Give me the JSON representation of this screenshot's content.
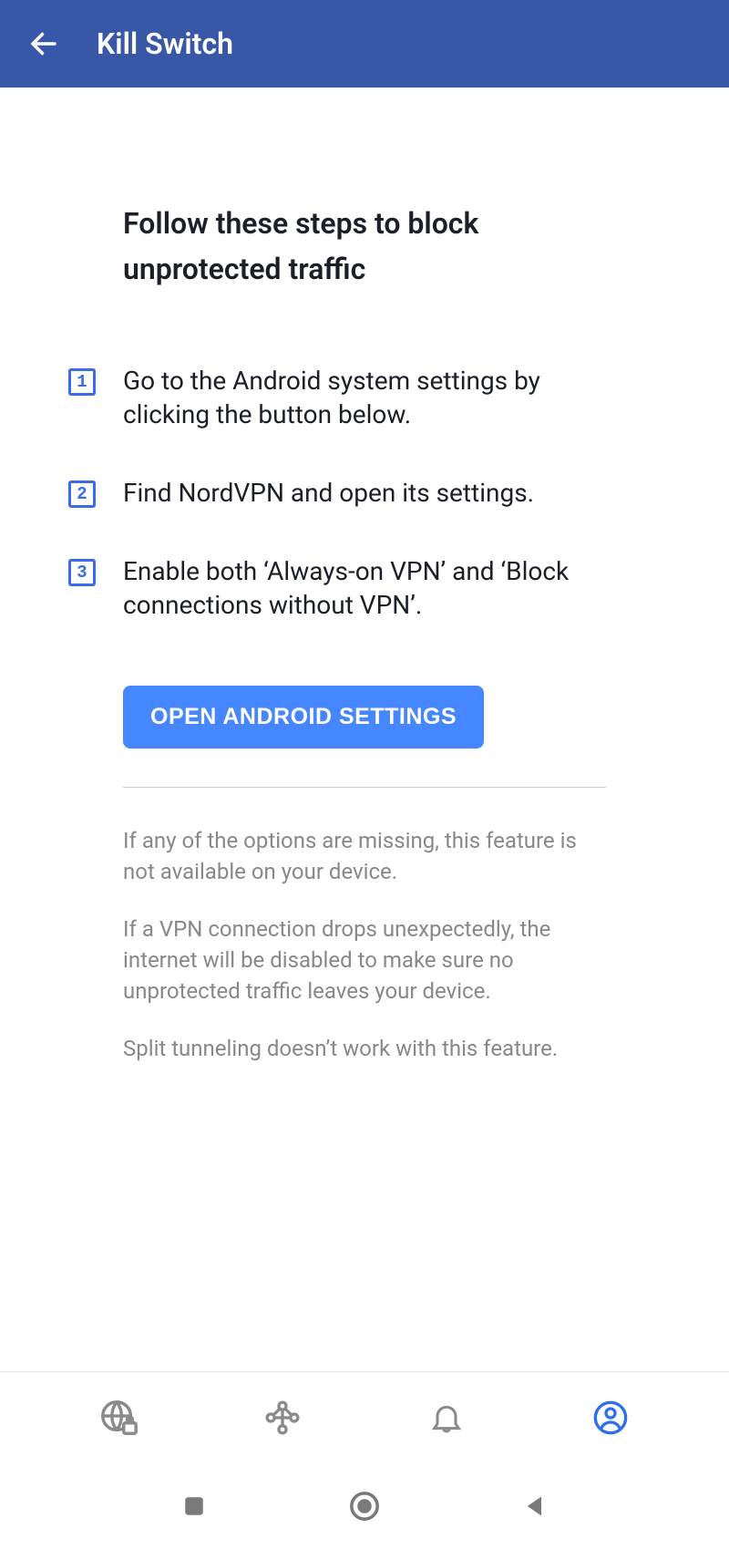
{
  "header": {
    "title": "Kill Switch"
  },
  "main": {
    "heading": "Follow these steps to block unprotected traffic",
    "steps": [
      {
        "num": "1",
        "text": "Go to the Android system settings by clicking the button below."
      },
      {
        "num": "2",
        "text": "Find NordVPN and open its settings."
      },
      {
        "num": "3",
        "text": "Enable both ‘Always-on VPN’ and ‘Block connections without VPN’."
      }
    ],
    "button_label": "OPEN ANDROID SETTINGS",
    "notes": [
      "If any of the options are missing, this feature is not available on your device.",
      "If a VPN connection drops unexpectedly, the internet will be disabled to make sure no unprotected traffic leaves your device.",
      "Split tunneling doesn’t work with this feature."
    ]
  }
}
